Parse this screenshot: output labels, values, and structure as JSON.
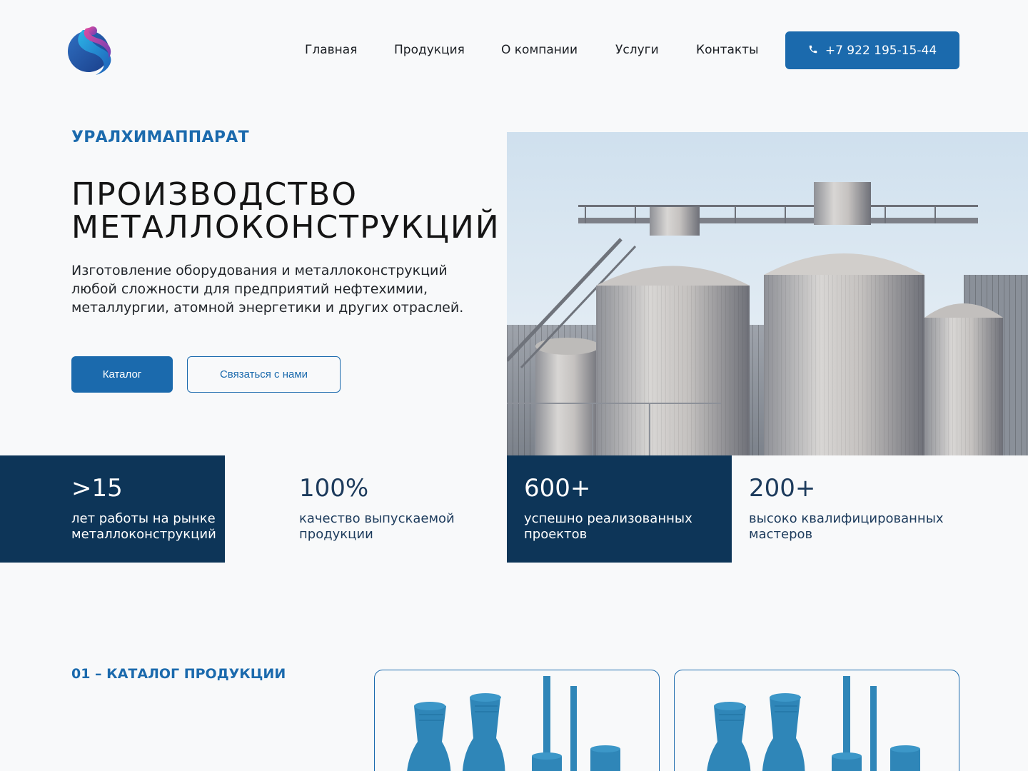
{
  "header": {
    "nav": [
      {
        "label": "Главная"
      },
      {
        "label": "Продукция"
      },
      {
        "label": "О компании"
      },
      {
        "label": "Услуги"
      },
      {
        "label": "Контакты"
      }
    ],
    "phone": "+7 922 195-15-44",
    "phone_icon": "phone-icon"
  },
  "hero": {
    "brand": "УРАЛХИМАППАРАТ",
    "title_line1": "ПРОИЗВОДСТВО",
    "title_line2": "МЕТАЛЛОКОНСТРУКЦИЙ",
    "description": "Изготовление оборудования и металлоконструкций любой сложности для предприятий нефтехимии, металлургии, атомной энергетики и других отраслей.",
    "catalog_button": "Каталог",
    "contact_button": "Связаться с нами"
  },
  "stats": [
    {
      "value": ">15",
      "label": "лет работы на рынке металлоконструкций"
    },
    {
      "value": "100%",
      "label": "качество выпускаемой продукции"
    },
    {
      "value": "600+",
      "label": "успешно реализованных проектов"
    },
    {
      "value": "200+",
      "label": "высоко квалифицированных мастеров"
    }
  ],
  "catalog": {
    "section_label": "01 – КАТАЛОГ ПРОДУКЦИИ"
  },
  "colors": {
    "accent": "#1b6aad",
    "dark_navy": "#0d3558",
    "background": "#f8f9fa"
  }
}
